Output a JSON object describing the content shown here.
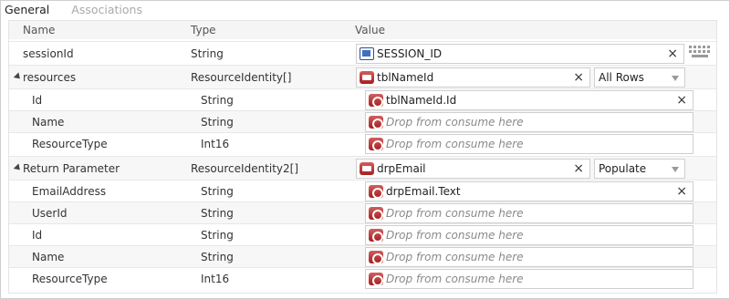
{
  "tabs": [
    {
      "label": "General",
      "active": true
    },
    {
      "label": "Associations",
      "active": false
    }
  ],
  "columns": {
    "name": "Name",
    "type": "Type",
    "value": "Value"
  },
  "rows": [
    {
      "name": "sessionId",
      "type": "String",
      "value": "SESSION_ID",
      "icon": "input-variable-icon",
      "placeholder": false
    },
    {
      "name": "resources",
      "type": "ResourceIdentity[]",
      "value": "tblNameId",
      "icon": "table-icon",
      "dropdown": "All Rows",
      "placeholder": false,
      "expanded": true
    },
    {
      "name": "Id",
      "type": "String",
      "value": "tblNameId.Id",
      "icon": "column-icon",
      "placeholder": false
    },
    {
      "name": "Name",
      "type": "String",
      "value": "Drop from consume here",
      "icon": "column-icon",
      "placeholder": true
    },
    {
      "name": "ResourceType",
      "type": "Int16",
      "value": "Drop from consume here",
      "icon": "column-icon",
      "placeholder": true
    },
    {
      "name": "Return Parameter",
      "type": "ResourceIdentity2[]",
      "value": "drpEmail",
      "icon": "dropdown-icon",
      "dropdown": "Populate",
      "placeholder": false,
      "expanded": true
    },
    {
      "name": "EmailAddress",
      "type": "String",
      "value": "drpEmail.Text",
      "icon": "column-icon",
      "placeholder": false
    },
    {
      "name": "UserId",
      "type": "String",
      "value": "Drop from consume here",
      "icon": "column-icon",
      "placeholder": true
    },
    {
      "name": "Id",
      "type": "String",
      "value": "Drop from consume here",
      "icon": "column-icon",
      "placeholder": true
    },
    {
      "name": "Name",
      "type": "String",
      "value": "Drop from consume here",
      "icon": "column-icon",
      "placeholder": true
    },
    {
      "name": "ResourceType",
      "type": "Int16",
      "value": "Drop from consume here",
      "icon": "column-icon",
      "placeholder": true
    }
  ],
  "clear_glyph": "×",
  "colors": {
    "accent_red": "#b22a2a",
    "accent_blue": "#2c4f8c",
    "border": "#cfcfcf"
  }
}
